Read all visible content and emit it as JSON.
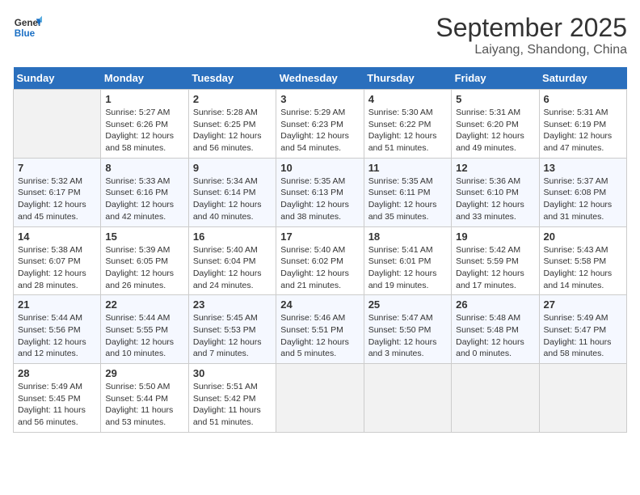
{
  "header": {
    "logo_line1": "General",
    "logo_line2": "Blue",
    "month": "September 2025",
    "location": "Laiyang, Shandong, China"
  },
  "weekdays": [
    "Sunday",
    "Monday",
    "Tuesday",
    "Wednesday",
    "Thursday",
    "Friday",
    "Saturday"
  ],
  "weeks": [
    [
      {
        "day": "",
        "info": ""
      },
      {
        "day": "1",
        "info": "Sunrise: 5:27 AM\nSunset: 6:26 PM\nDaylight: 12 hours\nand 58 minutes."
      },
      {
        "day": "2",
        "info": "Sunrise: 5:28 AM\nSunset: 6:25 PM\nDaylight: 12 hours\nand 56 minutes."
      },
      {
        "day": "3",
        "info": "Sunrise: 5:29 AM\nSunset: 6:23 PM\nDaylight: 12 hours\nand 54 minutes."
      },
      {
        "day": "4",
        "info": "Sunrise: 5:30 AM\nSunset: 6:22 PM\nDaylight: 12 hours\nand 51 minutes."
      },
      {
        "day": "5",
        "info": "Sunrise: 5:31 AM\nSunset: 6:20 PM\nDaylight: 12 hours\nand 49 minutes."
      },
      {
        "day": "6",
        "info": "Sunrise: 5:31 AM\nSunset: 6:19 PM\nDaylight: 12 hours\nand 47 minutes."
      }
    ],
    [
      {
        "day": "7",
        "info": "Sunrise: 5:32 AM\nSunset: 6:17 PM\nDaylight: 12 hours\nand 45 minutes."
      },
      {
        "day": "8",
        "info": "Sunrise: 5:33 AM\nSunset: 6:16 PM\nDaylight: 12 hours\nand 42 minutes."
      },
      {
        "day": "9",
        "info": "Sunrise: 5:34 AM\nSunset: 6:14 PM\nDaylight: 12 hours\nand 40 minutes."
      },
      {
        "day": "10",
        "info": "Sunrise: 5:35 AM\nSunset: 6:13 PM\nDaylight: 12 hours\nand 38 minutes."
      },
      {
        "day": "11",
        "info": "Sunrise: 5:35 AM\nSunset: 6:11 PM\nDaylight: 12 hours\nand 35 minutes."
      },
      {
        "day": "12",
        "info": "Sunrise: 5:36 AM\nSunset: 6:10 PM\nDaylight: 12 hours\nand 33 minutes."
      },
      {
        "day": "13",
        "info": "Sunrise: 5:37 AM\nSunset: 6:08 PM\nDaylight: 12 hours\nand 31 minutes."
      }
    ],
    [
      {
        "day": "14",
        "info": "Sunrise: 5:38 AM\nSunset: 6:07 PM\nDaylight: 12 hours\nand 28 minutes."
      },
      {
        "day": "15",
        "info": "Sunrise: 5:39 AM\nSunset: 6:05 PM\nDaylight: 12 hours\nand 26 minutes."
      },
      {
        "day": "16",
        "info": "Sunrise: 5:40 AM\nSunset: 6:04 PM\nDaylight: 12 hours\nand 24 minutes."
      },
      {
        "day": "17",
        "info": "Sunrise: 5:40 AM\nSunset: 6:02 PM\nDaylight: 12 hours\nand 21 minutes."
      },
      {
        "day": "18",
        "info": "Sunrise: 5:41 AM\nSunset: 6:01 PM\nDaylight: 12 hours\nand 19 minutes."
      },
      {
        "day": "19",
        "info": "Sunrise: 5:42 AM\nSunset: 5:59 PM\nDaylight: 12 hours\nand 17 minutes."
      },
      {
        "day": "20",
        "info": "Sunrise: 5:43 AM\nSunset: 5:58 PM\nDaylight: 12 hours\nand 14 minutes."
      }
    ],
    [
      {
        "day": "21",
        "info": "Sunrise: 5:44 AM\nSunset: 5:56 PM\nDaylight: 12 hours\nand 12 minutes."
      },
      {
        "day": "22",
        "info": "Sunrise: 5:44 AM\nSunset: 5:55 PM\nDaylight: 12 hours\nand 10 minutes."
      },
      {
        "day": "23",
        "info": "Sunrise: 5:45 AM\nSunset: 5:53 PM\nDaylight: 12 hours\nand 7 minutes."
      },
      {
        "day": "24",
        "info": "Sunrise: 5:46 AM\nSunset: 5:51 PM\nDaylight: 12 hours\nand 5 minutes."
      },
      {
        "day": "25",
        "info": "Sunrise: 5:47 AM\nSunset: 5:50 PM\nDaylight: 12 hours\nand 3 minutes."
      },
      {
        "day": "26",
        "info": "Sunrise: 5:48 AM\nSunset: 5:48 PM\nDaylight: 12 hours\nand 0 minutes."
      },
      {
        "day": "27",
        "info": "Sunrise: 5:49 AM\nSunset: 5:47 PM\nDaylight: 11 hours\nand 58 minutes."
      }
    ],
    [
      {
        "day": "28",
        "info": "Sunrise: 5:49 AM\nSunset: 5:45 PM\nDaylight: 11 hours\nand 56 minutes."
      },
      {
        "day": "29",
        "info": "Sunrise: 5:50 AM\nSunset: 5:44 PM\nDaylight: 11 hours\nand 53 minutes."
      },
      {
        "day": "30",
        "info": "Sunrise: 5:51 AM\nSunset: 5:42 PM\nDaylight: 11 hours\nand 51 minutes."
      },
      {
        "day": "",
        "info": ""
      },
      {
        "day": "",
        "info": ""
      },
      {
        "day": "",
        "info": ""
      },
      {
        "day": "",
        "info": ""
      }
    ]
  ]
}
